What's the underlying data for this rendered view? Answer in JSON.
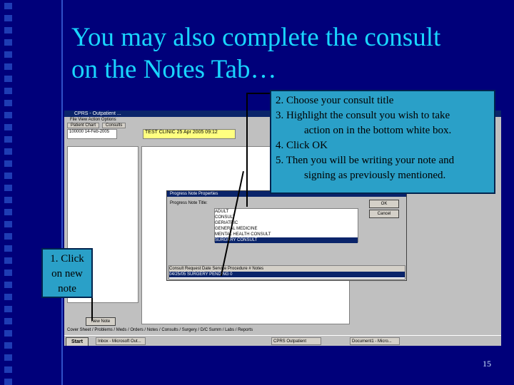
{
  "slide": {
    "title_line1": "You may also complete the consult",
    "title_line2": "on the Notes Tab…",
    "page_number": "15"
  },
  "callout_steps": {
    "step2": "2. Choose your consult title",
    "step3a": "3. Highlight the consult you wish to take",
    "step3b": "action on in the bottom white box.",
    "step4": "4. Click OK",
    "step5a": "5. Then you will be writing your note and",
    "step5b": "signing as previously mentioned."
  },
  "callout_new_note": {
    "line1": "1. Click",
    "line2": "on new",
    "line3": "note"
  },
  "screenshot": {
    "window_title": "CPRS - Outpatient ...",
    "menu": "File   View   Action   Options",
    "tabs": [
      "Patient Chart",
      "Consults"
    ],
    "patient_box": "100000   14-Feb-2005",
    "clinic_box": "TEST CLINIC   25 Apr 2005 09:12",
    "dialog_title": "Progress Note Properties",
    "dialog_label": "Progress Note Title:",
    "note_titles": [
      "ADULT",
      "CONSULT",
      "GERIATRIC",
      "GENERAL MEDICINE",
      "MENTAL HEALTH CONSULT",
      "SURGERY CONSULT"
    ],
    "selected_note_title": "SURGERY CONSULT",
    "ok_label": "OK",
    "cancel_label": "Cancel",
    "grid_header": "Consult Request Date   Service   Procedure   # Notes",
    "grid_row": "04/25/05   SURGERY   PENDING   0",
    "new_note_label": "New Note",
    "bottom_tabs": "Cover Sheet / Problems / Meds / Orders / Notes / Consults / Surgery / D/C Summ / Labs / Reports",
    "start_label": "Start",
    "tasks": [
      "Inbox - Microsoft Out...",
      "CPRS Outpatient",
      "Document1 - Micro..."
    ]
  }
}
